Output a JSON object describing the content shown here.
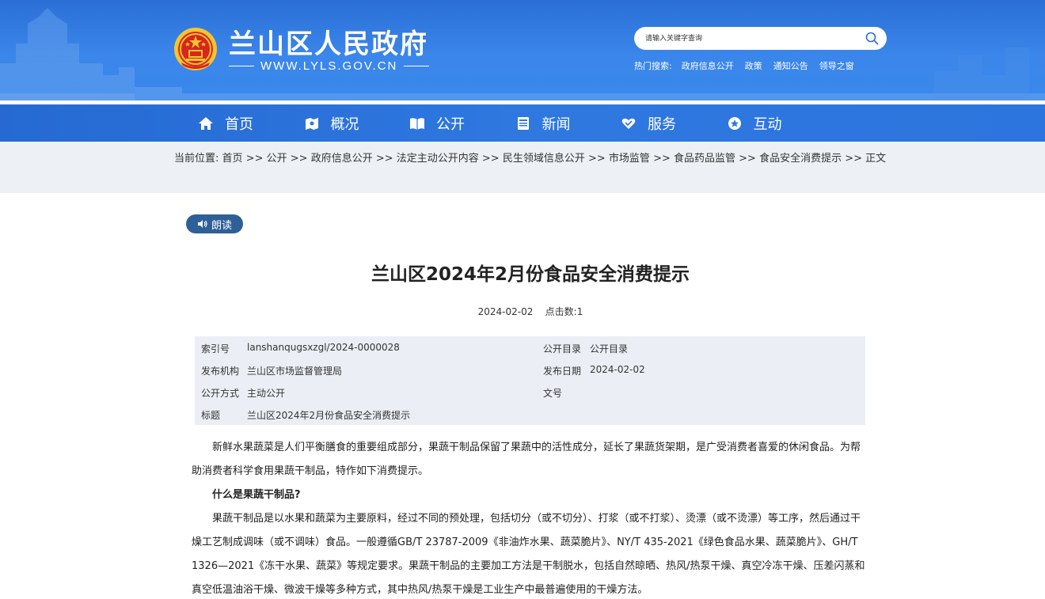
{
  "header": {
    "site_title": "兰山区人民政府",
    "site_url": "WWW.LYLS.GOV.CN",
    "search": {
      "placeholder": "请输入关键字查询"
    },
    "hot_label": "热门搜索:",
    "hot_links": [
      "政府信息公开",
      "政策",
      "通知公告",
      "领导之窗"
    ]
  },
  "nav": {
    "items": [
      {
        "label": "首页",
        "icon": "home-icon"
      },
      {
        "label": "概况",
        "icon": "overview-icon"
      },
      {
        "label": "公开",
        "icon": "book-icon"
      },
      {
        "label": "新闻",
        "icon": "news-icon"
      },
      {
        "label": "服务",
        "icon": "service-icon"
      },
      {
        "label": "互动",
        "icon": "chat-icon"
      }
    ]
  },
  "breadcrumb": {
    "prefix": "当前位置:",
    "separator": " >> ",
    "items": [
      "首页",
      "公开",
      "政府信息公开",
      "法定主动公开内容",
      "民生领域信息公开",
      "市场监管",
      "食品药品监管",
      "食品安全消费提示",
      "正文"
    ]
  },
  "article": {
    "read_label": "朗读",
    "title": "兰山区2024年2月份食品安全消费提示",
    "date": "2024-02-02",
    "hits_label": "点击数:",
    "hits": "1",
    "info": [
      [
        {
          "k": "索引号",
          "v": "lanshanqugsxzgl/2024-0000028"
        },
        {
          "k": "公开目录",
          "v": "公开目录"
        }
      ],
      [
        {
          "k": "发布机构",
          "v": "兰山区市场监督管理局"
        },
        {
          "k": "发布日期",
          "v": "2024-02-02"
        }
      ],
      [
        {
          "k": "公开方式",
          "v": "主动公开"
        },
        {
          "k": "文号",
          "v": ""
        }
      ],
      [
        {
          "k": "标题",
          "v": "兰山区2024年2月份食品安全消费提示"
        }
      ]
    ],
    "paragraphs": [
      {
        "type": "text",
        "text": "新鲜水果蔬菜是人们平衡膳食的重要组成部分，果蔬干制品保留了果蔬中的活性成分，延长了果蔬货架期，是广受消费者喜爱的休闲食品。为帮助消费者科学食用果蔬干制品，特作如下消费提示。"
      },
      {
        "type": "heading",
        "text": "什么是果蔬干制品?"
      },
      {
        "type": "text",
        "text": "果蔬干制品是以水果和蔬菜为主要原料，经过不同的预处理，包括切分（或不切分）、打浆（或不打浆）、烫漂（或不烫漂）等工序，然后通过干燥工艺制成调味（或不调味）食品。一般遵循GB/T 23787-2009《非油炸水果、蔬菜脆片》、NY/T 435-2021《绿色食品水果、蔬菜脆片》、GH/T 1326—2021《冻干水果、蔬菜》等规定要求。果蔬干制品的主要加工方法是干制脱水，包括自然晾晒、热风/热泵干燥、真空冷冻干燥、压差闪蒸和真空低温油浴干燥、微波干燥等多种方式，其中热风/热泵干燥是工业生产中最普遍使用的干燥方法。"
      }
    ]
  },
  "colors": {
    "header_blue": "#3b86ea",
    "nav_blue": "#2e78e0",
    "crumb_bg": "#edf1f6",
    "read_button": "#2f5f97",
    "info_bg": "#ebeff5"
  }
}
